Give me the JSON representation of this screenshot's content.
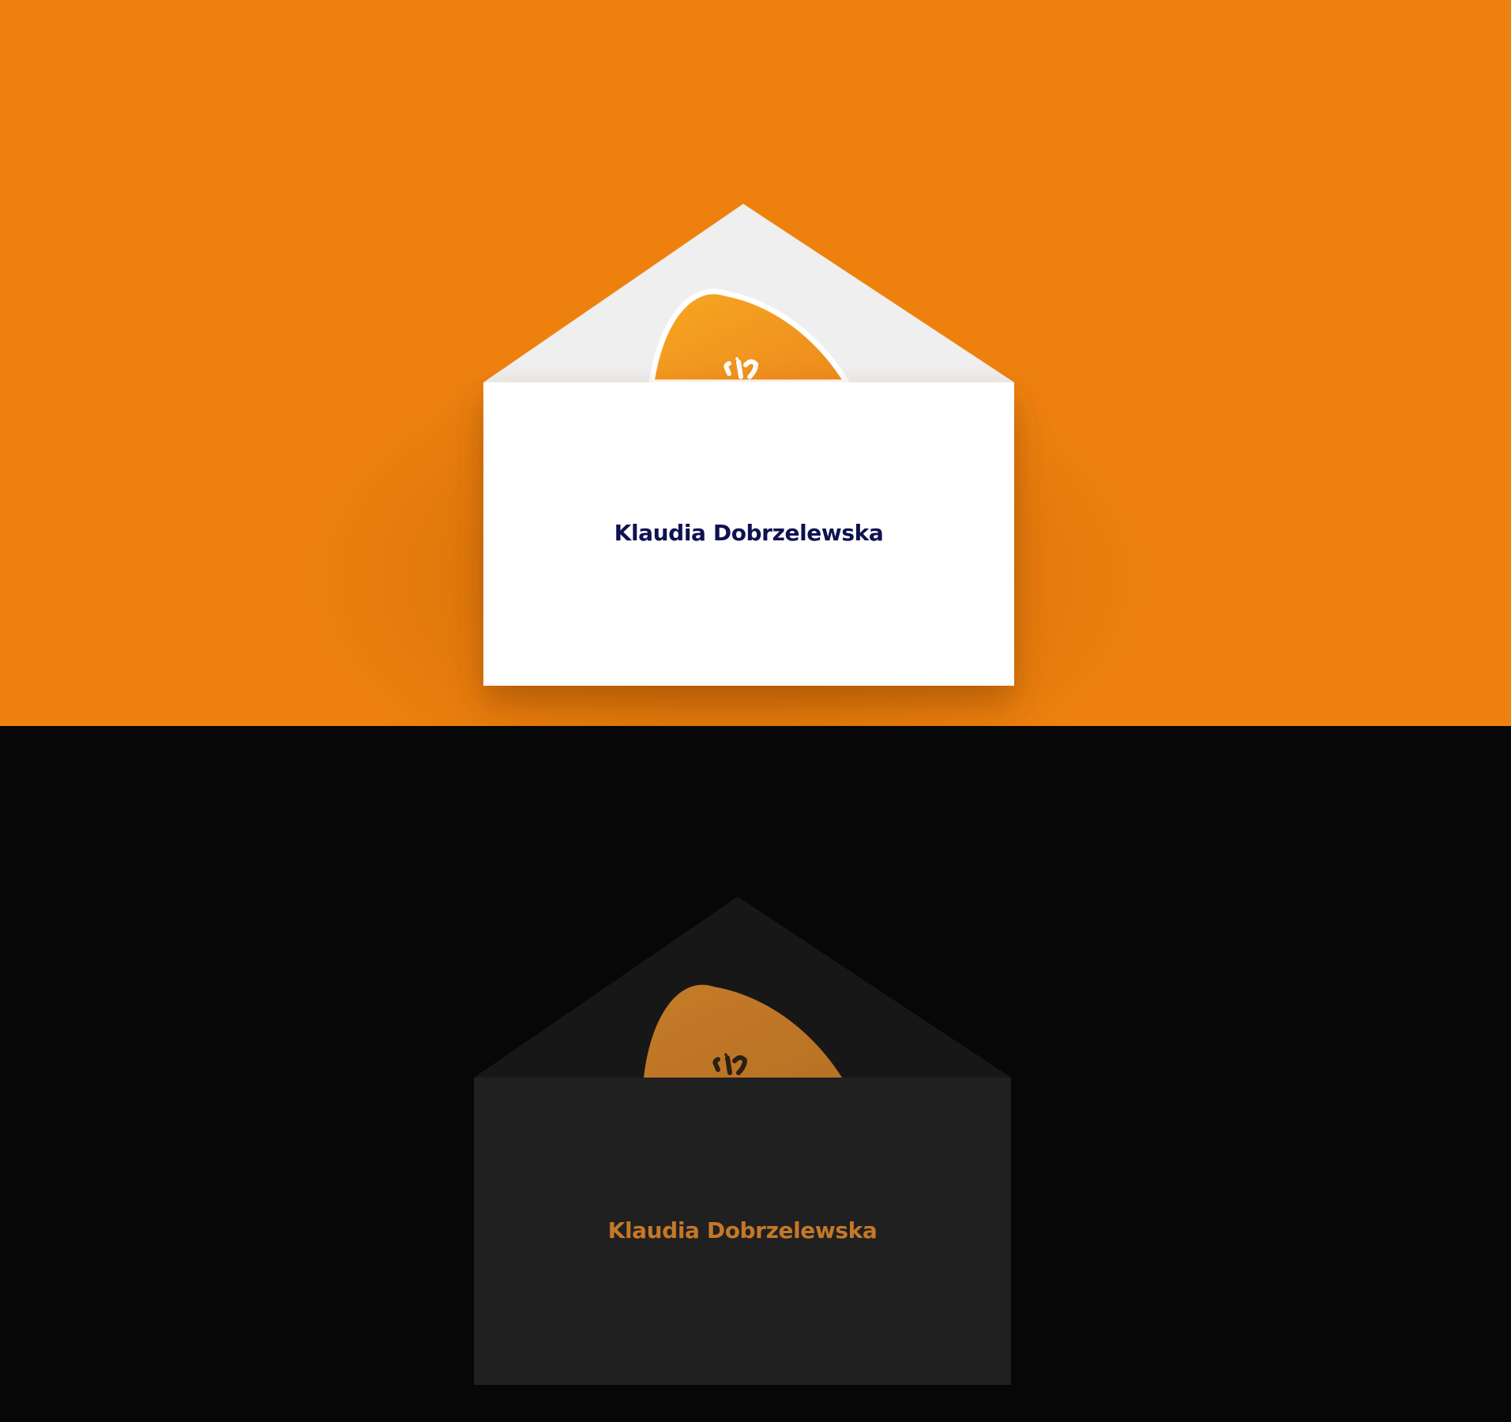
{
  "colors": {
    "orange_background": "#ee810e",
    "dark_background": "#070707",
    "light_envelope_body": "#ffffff",
    "light_envelope_flap": "#efefef",
    "light_name_color": "#0f1250",
    "dark_envelope_body": "#202020",
    "dark_envelope_flap": "#171717",
    "dark_name_color": "#c4782a",
    "card_orange_light": "#f4a125",
    "card_orange_dark": "#c27a28",
    "card_monogram_light": "#ffffff",
    "card_monogram_dark": "#2a1f13"
  },
  "light_variant": {
    "name": "Klaudia Dobrzelewska",
    "card_icon": "monogram-logo-icon"
  },
  "dark_variant": {
    "name": "Klaudia Dobrzelewska",
    "card_icon": "monogram-logo-icon"
  }
}
